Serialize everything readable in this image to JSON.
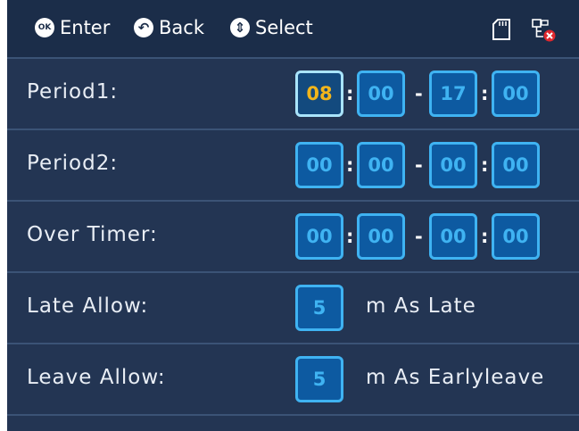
{
  "hints": {
    "enter_icon": "OK",
    "enter": "Enter",
    "back_icon": "back-icon",
    "back": "Back",
    "select_icon": "select-icon",
    "select": "Select"
  },
  "status_icons": [
    "sd-card-icon",
    "network-disconnected-icon"
  ],
  "rows": {
    "period1": {
      "label": "Period1:",
      "start_hour": "08",
      "start_min": "00",
      "end_hour": "17",
      "end_min": "00",
      "focused_field": "start_hour"
    },
    "period2": {
      "label": "Period2:",
      "start_hour": "00",
      "start_min": "00",
      "end_hour": "00",
      "end_min": "00"
    },
    "over_timer": {
      "label": "Over Timer:",
      "start_hour": "00",
      "start_min": "00",
      "end_hour": "00",
      "end_min": "00"
    },
    "late_allow": {
      "label": "Late Allow:",
      "value": "5",
      "suffix": "m As Late"
    },
    "leave_allow": {
      "label": "Leave Allow:",
      "value": "5",
      "suffix": "m As Earlyleave"
    }
  },
  "separators": {
    "colon": ":",
    "dash": "-"
  },
  "colors": {
    "background": "#233553",
    "header": "#1b2d49",
    "field_border": "#3fb3f2",
    "field_fill": "#0d5aa1",
    "focused_text": "#f1b51b",
    "alert_red": "#e0282e"
  }
}
